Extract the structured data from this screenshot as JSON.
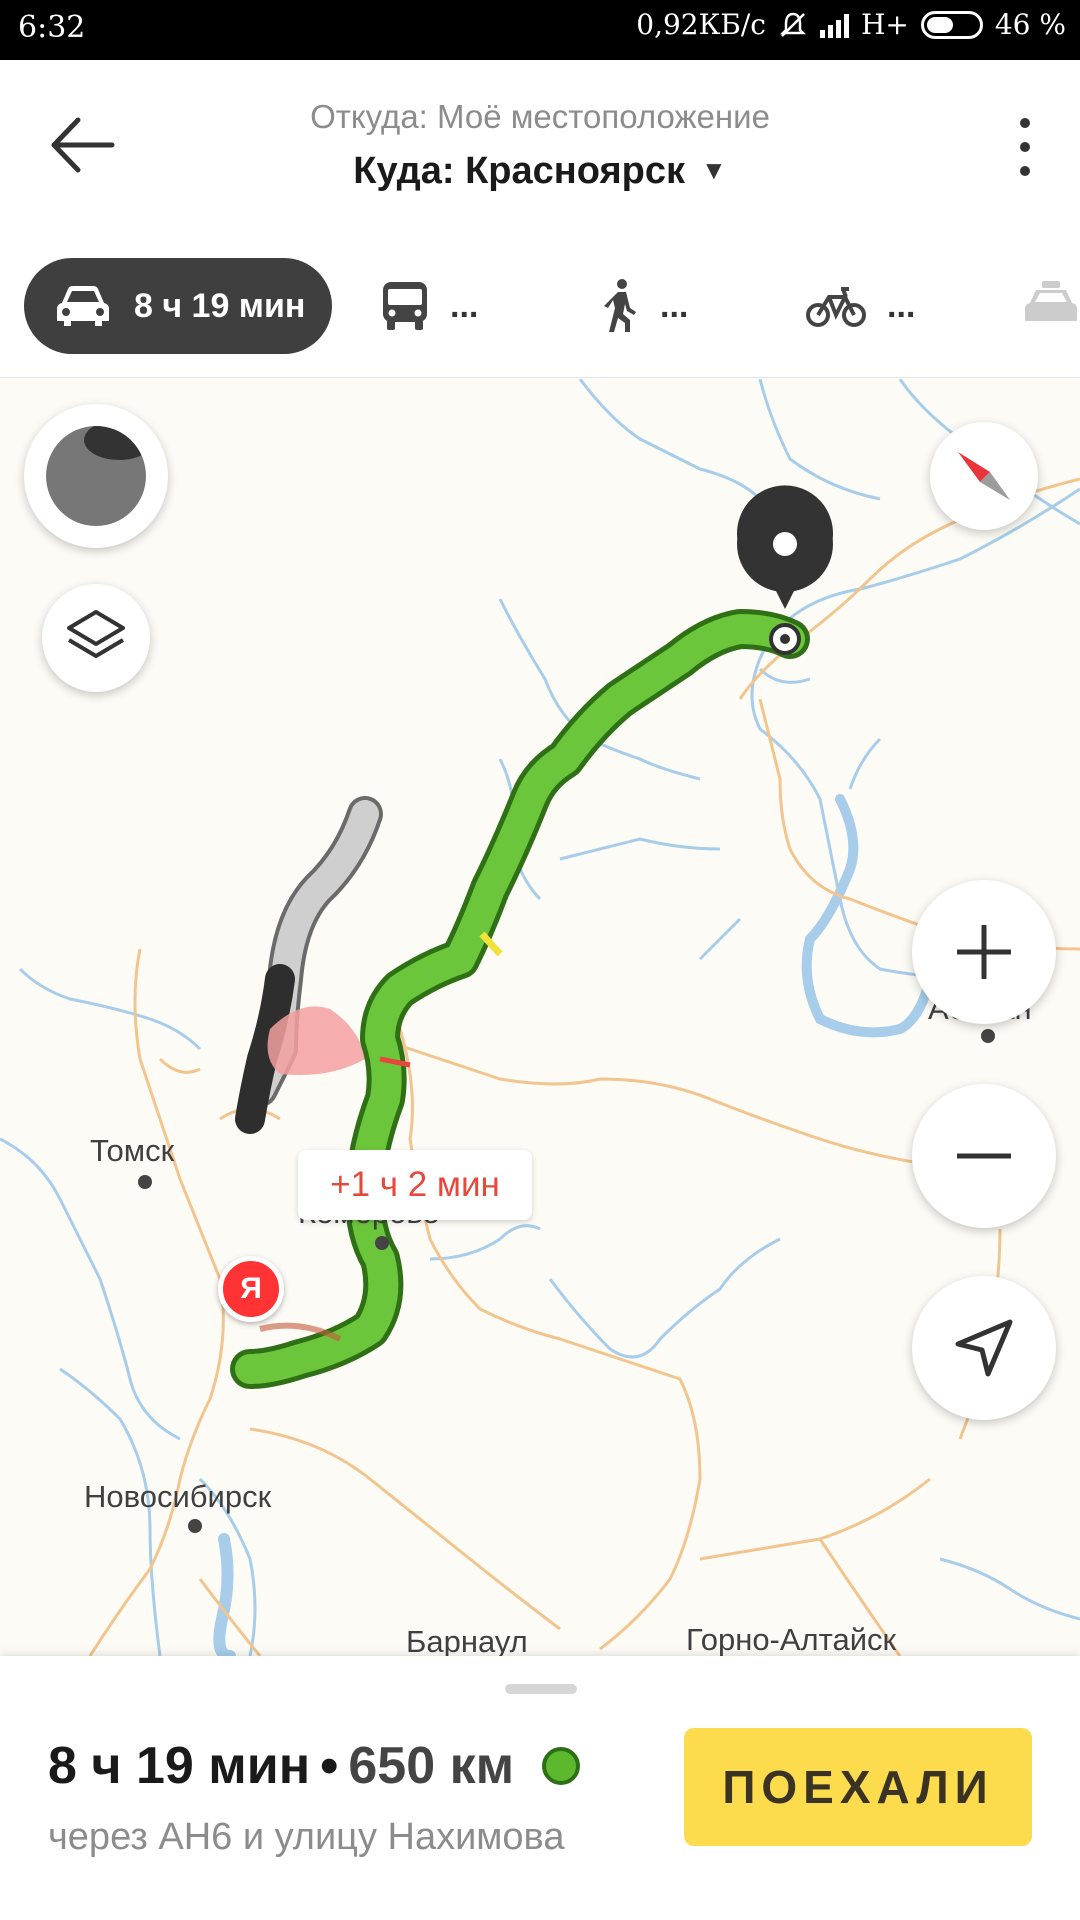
{
  "status_bar": {
    "time": "6:32",
    "network_speed": "0,92КБ/с",
    "network_type": "H+",
    "battery": "46 %"
  },
  "header": {
    "from": "Откуда: Моё местоположение",
    "to": "Куда: Красноярск",
    "caret": "▼"
  },
  "modes": {
    "car": {
      "icon": "car-icon",
      "label": "8 ч 19 мин"
    },
    "transit": {
      "icon": "bus-icon",
      "label": "..."
    },
    "walk": {
      "icon": "walk-icon",
      "label": "..."
    },
    "bike": {
      "icon": "bike-icon",
      "label": "..."
    },
    "taxi": {
      "icon": "taxi-icon"
    }
  },
  "map": {
    "cities": {
      "tomsk": "Томск",
      "kemerovo": "Кемерово",
      "novosibirsk": "Новосибирск",
      "barnaul": "Барнаул",
      "gorno_altaysk": "Горно-Алтайск",
      "abakan": "Абакан"
    },
    "traffic_delay": "+1 ч 2 мин",
    "start_marker_letter": "Я",
    "colors": {
      "route": "#6cc63b",
      "alt_route": "#c9c9c9",
      "traffic_jam": "#e8473c",
      "rivers": "#9ec8e6",
      "roads": "#f3c98f"
    }
  },
  "bottom_sheet": {
    "duration": "8 ч 19 мин",
    "separator": "•",
    "distance": "650 км",
    "via": "через АН6 и улицу Нахимова",
    "go_button": "ПОЕХАЛИ"
  }
}
